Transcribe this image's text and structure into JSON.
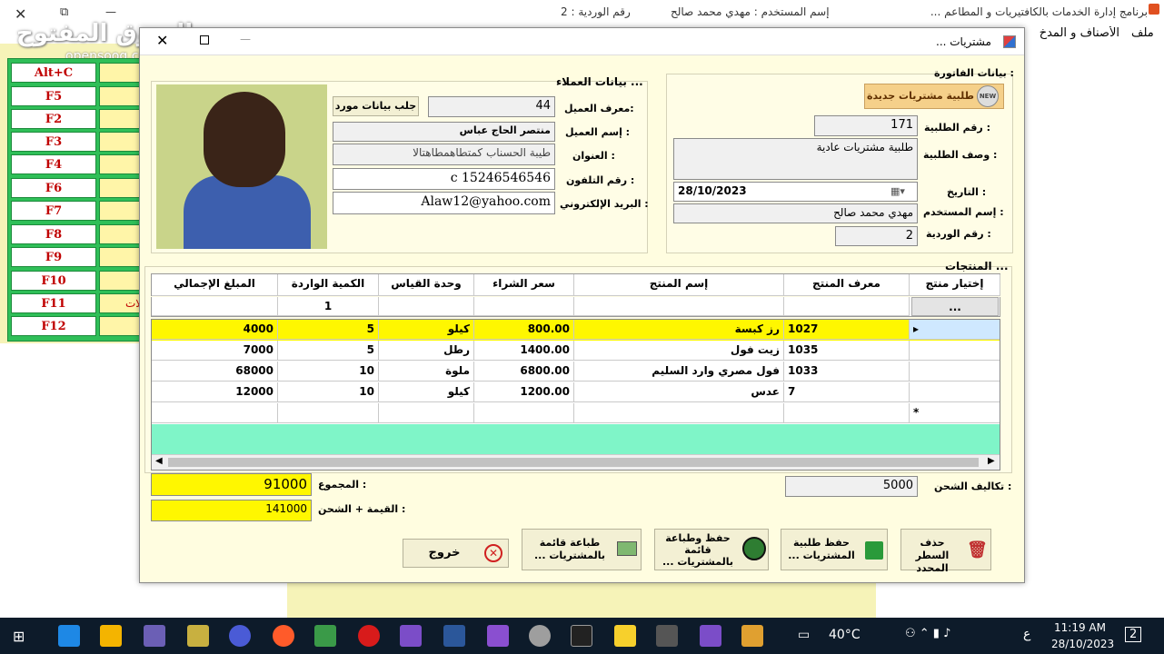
{
  "bg": {
    "title": "برنامج إدارة الخدمات  بالكافتيريات و المطاعم ...",
    "user_label": "إسم المستخدم : مهدي محمد صالح",
    "shift_label": "رقم الوردية :  2",
    "menu": [
      "ملف",
      "الأصناف و المدخ"
    ],
    "watermark": "السوق المفتوح",
    "watermark_sub": "opensooq.com",
    "fkeys": [
      "Alt+C",
      "F5",
      "F2",
      "F3",
      "F4",
      "F6",
      "F7",
      "F8",
      "F9",
      "F10",
      "F11",
      "F12"
    ],
    "f11_side": "ملات"
  },
  "dialog": {
    "title": "مشتريات ...",
    "invoice_section": "بيانات الفاتورة :",
    "new_order_button": "طلبية مشتريات جديدة",
    "new_badge": "NEW",
    "order_no_label": "رقم الطلبية :",
    "order_no": "171",
    "order_desc_label": "وصف الطلبية :",
    "order_desc": "طلبية مشتريات عادية",
    "date_label": "التاريخ :",
    "date": "28/10/2023",
    "user_label": "إسم المستخدم :",
    "user": "مهدي محمد صالح",
    "shift_label": "رقم الوردية :",
    "shift": "2",
    "customer_section": "بيانات العملاء ...",
    "fetch_supplier_button": "جلب بيانات مورد",
    "customer_id_label": "معرف العميل:",
    "customer_id": "44",
    "customer_name_label": "إسم العميل :",
    "customer_name": "منتصر الحاج عباس",
    "address_label": "العنوان :",
    "address": "طيبة الحسناب كمتطاهمطاهتالا",
    "phone_label": "رقم التلفون :",
    "phone": "c  15246546546",
    "email_label": "البريد الإلكتروني :",
    "email": "Alaw12@yahoo.com",
    "products_section": "المنتجات ...",
    "columns": [
      "إختيار منتج",
      "معرف المنتج",
      "إسم المنتج",
      "سعر الشراء",
      "وحدة القياس",
      "الكمية الواردة",
      "المبلغ الإجمالي"
    ],
    "entry_row": {
      "select": "...",
      "qty": "1"
    },
    "rows": [
      {
        "id": "1027",
        "name": "رز كبسة",
        "price": "800.00",
        "unit": "كيلو",
        "qty": "5",
        "total": "4000"
      },
      {
        "id": "1035",
        "name": "زيت فول",
        "price": "1400.00",
        "unit": "رطل",
        "qty": "5",
        "total": "7000"
      },
      {
        "id": "1033",
        "name": "فول مصري وارد السليم",
        "price": "6800.00",
        "unit": "ملوة",
        "qty": "10",
        "total": "68000"
      },
      {
        "id": "7",
        "name": "عدس",
        "price": "1200.00",
        "unit": "كيلو",
        "qty": "10",
        "total": "12000"
      }
    ],
    "new_row_marker": "*",
    "shipping_label": "تكاليف الشحن :",
    "shipping": "5000",
    "sum_label": "المجموع :",
    "sum": "91000",
    "value_plus_shipping_label": "القيمة + الشحن :",
    "value_plus_shipping": "141000",
    "buttons": {
      "delete_row": "حذف السطر المحدد",
      "save_order": "حفظ طلبية المشتريات ...",
      "save_print": "حفظ وطباعة قائمة بالمشتريات ...",
      "print_list": "طباعة قائمة بالمشتريات ...",
      "exit": "خروج"
    }
  },
  "taskbar": {
    "temperature": "40°C",
    "lang": "ع",
    "time": "11:19 AM",
    "date": "28/10/2023",
    "notifications": "2"
  },
  "colors": {
    "highlight": "#fff700",
    "grid_empty": "#7ff5c8",
    "fkey_green": "#2fbf58"
  }
}
